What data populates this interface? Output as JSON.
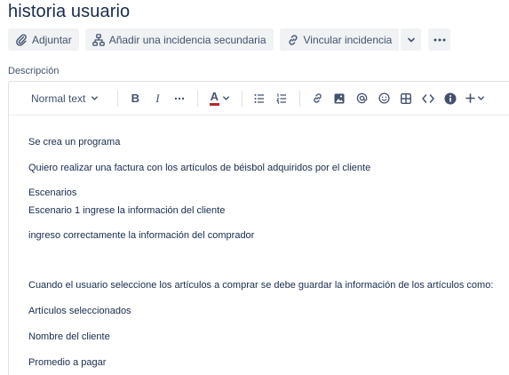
{
  "issue": {
    "title": "historia usuario"
  },
  "actions": {
    "attach": {
      "label": "Adjuntar",
      "icon": "paperclip-icon"
    },
    "child_issue": {
      "label": "Añadir una incidencia secundaria",
      "icon": "hierarchy-icon"
    },
    "link_issue": {
      "label": "Vincular incidencia",
      "icon": "link-icon"
    },
    "dropdown": {
      "icon": "chevron-down-icon"
    },
    "more": {
      "icon": "more-icon"
    }
  },
  "description": {
    "label": "Descripción",
    "toolbar": {
      "text_style": "Normal text",
      "bold": "B",
      "italic": "I",
      "text_color": "A"
    },
    "paragraphs": [
      "Se crea un programa",
      "Quiero realizar una factura con los artículos de béisbol adquiridos por el cliente",
      "Escenarios",
      "Escenario 1 ingrese la información  del cliente",
      "ingreso correctamente la información del comprador",
      "",
      "Cuando el usuario seleccione los artículos a comprar se debe guardar la información de los artículos como:",
      "Artículos seleccionados",
      "Nombre del cliente",
      "Promedio a pagar"
    ]
  },
  "colors": {
    "text": "#172b4d",
    "subtle": "#42526e",
    "button_bg": "#f1f2f4",
    "border": "#dfe1e6"
  }
}
